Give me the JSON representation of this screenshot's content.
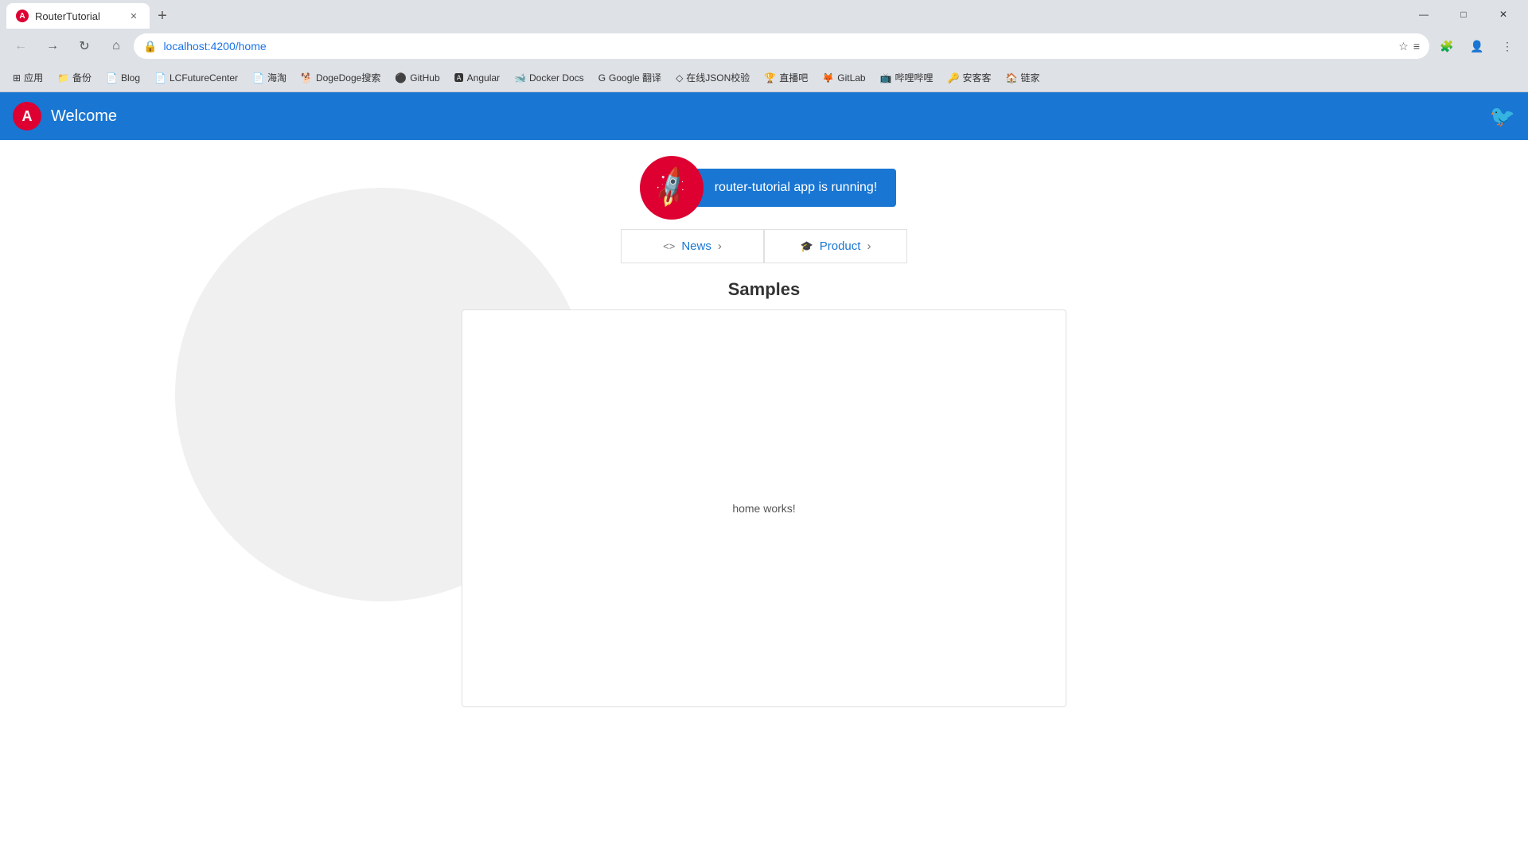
{
  "browser": {
    "tab": {
      "title": "RouterTutorial",
      "favicon": "A"
    },
    "address": "localhost:4200/home",
    "window_controls": {
      "minimize": "—",
      "maximize": "□",
      "close": "✕"
    }
  },
  "bookmarks": [
    {
      "label": "应用",
      "icon": "⊞"
    },
    {
      "label": "备份",
      "icon": "📁"
    },
    {
      "label": "Blog",
      "icon": "📄"
    },
    {
      "label": "LCFutureCenter",
      "icon": "📄"
    },
    {
      "label": "海淘",
      "icon": "📄"
    },
    {
      "label": "DogeDoge搜索",
      "icon": "🐕"
    },
    {
      "label": "GitHub",
      "icon": "⚫"
    },
    {
      "label": "Angular",
      "icon": "🅰"
    },
    {
      "label": "Docker Docs",
      "icon": "🐋"
    },
    {
      "label": "Google 翻译",
      "icon": "G"
    },
    {
      "label": "在线JSON校验",
      "icon": "◇"
    },
    {
      "label": "直播吧",
      "icon": "🏆"
    },
    {
      "label": "GitLab",
      "icon": "🦊"
    },
    {
      "label": "哔哩哔哩",
      "icon": "📺"
    },
    {
      "label": "安客客",
      "icon": "🔑"
    },
    {
      "label": "链家",
      "icon": "🏠"
    }
  ],
  "app": {
    "header": {
      "logo_text": "A",
      "title": "Welcome",
      "twitter_label": "Twitter"
    },
    "hero": {
      "banner_text": "router-tutorial app is running!"
    },
    "nav_links": [
      {
        "icon_code": "code",
        "label": "News",
        "has_chevron": true
      },
      {
        "icon_code": "mortar-board",
        "label": "Product",
        "has_chevron": true
      }
    ],
    "samples": {
      "title": "Samples",
      "content_text": "home works!"
    }
  }
}
